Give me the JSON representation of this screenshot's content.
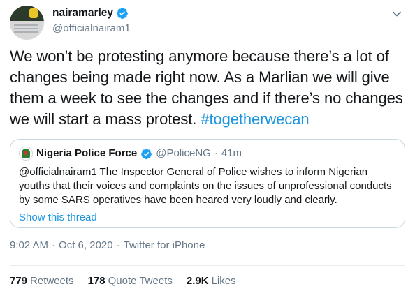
{
  "author": {
    "display_name": "nairamarley",
    "handle": "@officialnairam1"
  },
  "tweet": {
    "text": "We won’t be protesting anymore because there’s a lot of changes being made right now. As a Marlian we will give them a week to see the changes and if there’s no changes we will start a mass protest. ",
    "hashtag": "#togetherwecan"
  },
  "quote": {
    "display_name": "Nigeria Police Force",
    "handle": "@PoliceNG",
    "separator": "·",
    "time": "41m",
    "text": "@officialnairam1 The Inspector General of Police wishes to inform Nigerian youths that their voices and complaints on the issues of unprofessional conducts by some SARS operatives have been heared very loudly and clearly.",
    "show_thread": "Show this thread"
  },
  "meta": {
    "time": "9:02 AM",
    "sep1": "·",
    "date": "Oct 6, 2020",
    "sep2": "·",
    "source": "Twitter for iPhone"
  },
  "stats": {
    "retweets_count": "779",
    "retweets_label": "Retweets",
    "quotes_count": "178",
    "quotes_label": "Quote Tweets",
    "likes_count": "2.9K",
    "likes_label": "Likes"
  },
  "icons": {
    "verified": "verified-badge-icon",
    "caret": "chevron-down-icon"
  },
  "colors": {
    "link": "#1b95e0",
    "verified": "#1da1f2",
    "secondary_text": "#657786",
    "border": "#ccd6dd"
  }
}
